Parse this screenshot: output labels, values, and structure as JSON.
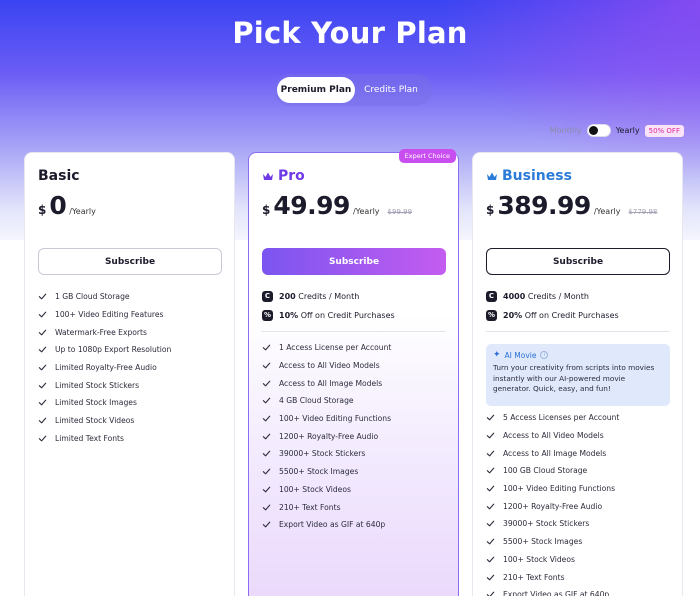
{
  "header": {
    "title": "Pick Your Plan",
    "plan_tabs": [
      {
        "label": "Premium Plan",
        "active": true
      },
      {
        "label": "Credits Plan",
        "active": false
      }
    ]
  },
  "billing": {
    "monthly_label": "Monthly",
    "yearly_label": "Yearly",
    "discount_badge": "50% OFF",
    "selected": "Yearly"
  },
  "plans": {
    "basic": {
      "name": "Basic",
      "currency": "$",
      "price": "0",
      "period": "/Yearly",
      "subscribe_label": "Subscribe",
      "features": [
        "1 GB Cloud Storage",
        "100+ Video Editing Features",
        "Watermark-Free Exports",
        "Up to 1080p Export Resolution",
        "Limited Royalty-Free Audio",
        "Limited Stock Stickers",
        "Limited Stock Images",
        "Limited Stock Videos",
        "Limited Text Fonts"
      ]
    },
    "pro": {
      "badge": "Expert Choice",
      "name": "Pro",
      "currency": "$",
      "price": "49.99",
      "period": "/Yearly",
      "old_price": "$99.99",
      "subscribe_label": "Subscribe",
      "credits": {
        "icon": "C",
        "amount": "200",
        "text": "Credits / Month"
      },
      "discount": {
        "icon": "%",
        "amount": "10%",
        "text": "Off on Credit Purchases"
      },
      "features": [
        "1 Access License per Account",
        "Access to All Video Models",
        "Access to All Image Models",
        "4 GB Cloud Storage",
        "100+ Video Editing Functions",
        "1200+ Royalty-Free Audio",
        "39000+ Stock Stickers",
        "5500+ Stock Images",
        "100+ Stock Videos",
        "210+ Text Fonts",
        "Export Video as GIF at 640p"
      ]
    },
    "business": {
      "name": "Business",
      "currency": "$",
      "price": "389.99",
      "period": "/Yearly",
      "old_price": "$779.98",
      "subscribe_label": "Subscribe",
      "credits": {
        "icon": "C",
        "amount": "4000",
        "text": "Credits / Month"
      },
      "discount": {
        "icon": "%",
        "amount": "20%",
        "text": "Off on Credit Purchases"
      },
      "ai_movie": {
        "title": "AI Movie",
        "description": "Turn your creativity from scripts into movies instantly with our AI-powered movie generator. Quick, easy, and fun!"
      },
      "features": [
        "5 Access Licenses per Account",
        "Access to All Video Models",
        "Access to All Image Models",
        "100 GB Cloud Storage",
        "100+ Video Editing Functions",
        "1200+ Royalty-Free Audio",
        "39000+ Stock Stickers",
        "5500+ Stock Images",
        "100+ Stock Videos",
        "210+ Text Fonts",
        "Export Video as GIF at 640p"
      ]
    }
  },
  "colors": {
    "pro_accent": "#6f3ae8",
    "business_accent": "#2b7bd8",
    "badge_pink": "#d9279e"
  }
}
